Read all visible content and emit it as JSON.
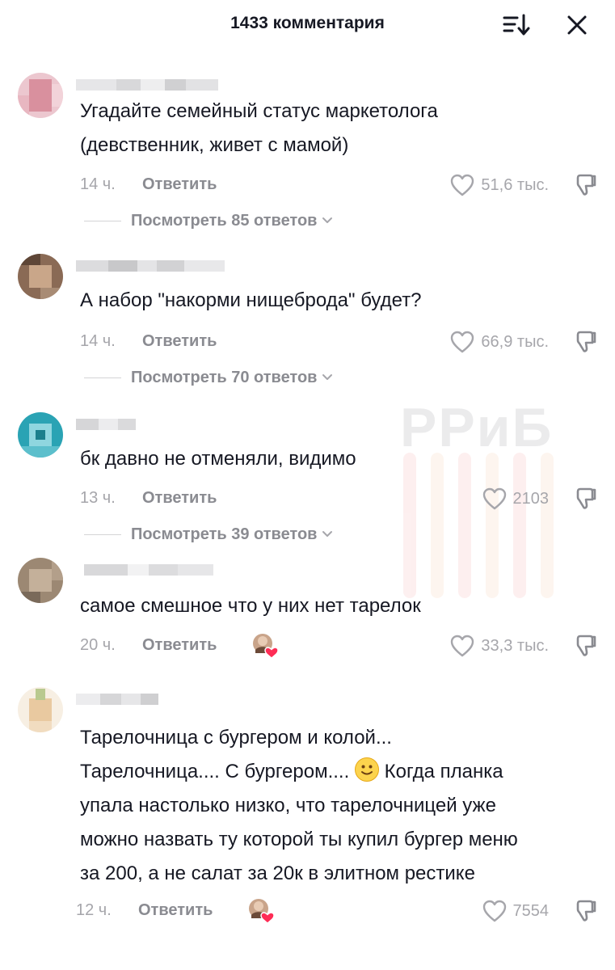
{
  "header": {
    "title": "1433 комментария",
    "sort_icon": "sort-icon",
    "close_icon": "close-icon"
  },
  "watermark": {
    "text": "РРиБ"
  },
  "comments": [
    {
      "text_lines": [
        "Угадайте семейный статус маркетолога",
        "(девственник, живет с мамой)"
      ],
      "time": "14 ч.",
      "reply_label": "Ответить",
      "likes": "51,6 тыс.",
      "view_replies": "Посмотреть 85 ответов"
    },
    {
      "text_lines": [
        "А набор \"накорми нищеброда\" будет?"
      ],
      "time": "14 ч.",
      "reply_label": "Ответить",
      "likes": "66,9 тыс.",
      "view_replies": "Посмотреть 70 ответов"
    },
    {
      "text_lines": [
        "бк давно не отменяли, видимо"
      ],
      "time": "13 ч.",
      "reply_label": "Ответить",
      "likes": "2103",
      "view_replies": "Посмотреть 39 ответов"
    },
    {
      "text_lines": [
        "самое смешное что у них нет тарелок"
      ],
      "time": "20 ч.",
      "reply_label": "Ответить",
      "likes": "33,3 тыс.",
      "creator_liked": true
    },
    {
      "text_line_1": "Тарелочница с бургером и колой...",
      "text_line_2_a": "Тарелочница.... С бургером....",
      "text_line_2_b": "Когда планка",
      "text_line_3": "упала настолько низко, что тарелочницей уже",
      "text_line_4": "можно назвать ту которой ты купил бургер меню",
      "text_line_5": "за 200, а не салат за 20к в элитном рестике",
      "time": "12 ч.",
      "reply_label": "Ответить",
      "likes": "7554",
      "creator_liked": true
    }
  ],
  "icons": {
    "like": "heart-outline-icon",
    "dislike": "thumbs-down-icon",
    "chevron": "chevron-down-icon",
    "emoji": "slightly-smiling-face-emoji"
  },
  "colors": {
    "text_primary": "#161823",
    "text_secondary": "#8a8b91",
    "text_muted": "#a6a6ab",
    "creator_heart": "#fe2c55"
  }
}
